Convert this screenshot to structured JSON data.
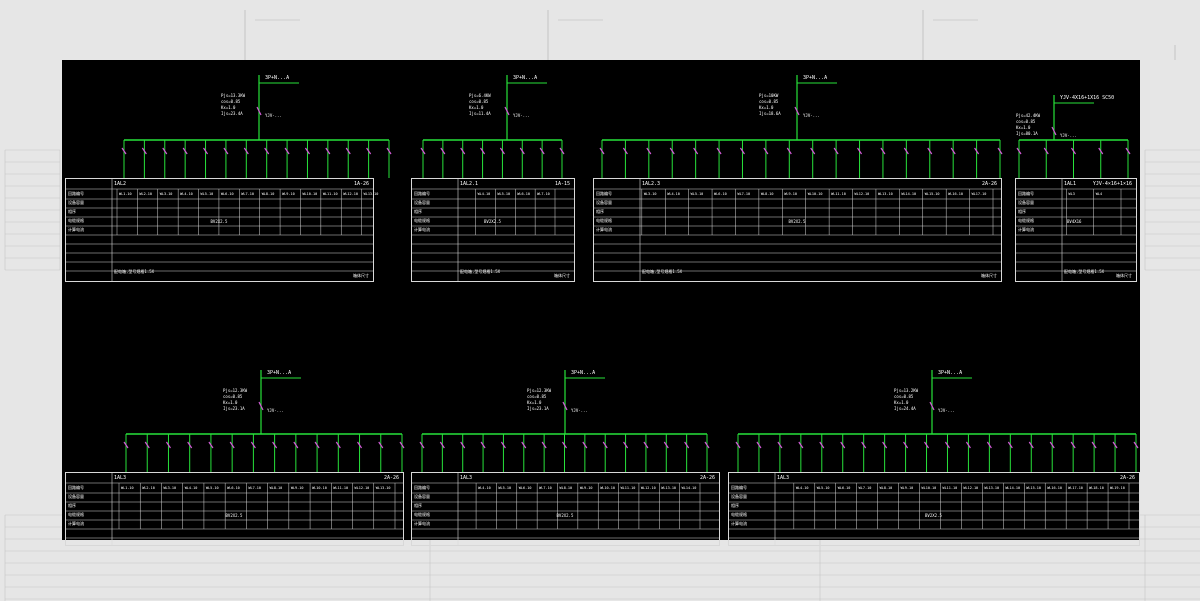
{
  "panels": [
    {
      "id": "p1",
      "title": "1AL2",
      "code": "1A-26",
      "power": "Pjs=13.3KW",
      "cos": "cos=0.85",
      "kx": "Kx=1.0",
      "ij": "Ijs=23.4A",
      "breaker": "3P+N...A",
      "feed": "YJV-...",
      "footer": "配电箱,型号规格1.5X",
      "note": "箱体尺寸",
      "circuits": 14,
      "rows": [
        "WL1-10",
        "WL2-10",
        "WL3-10",
        "WL4-10",
        "WL5-10",
        "WL6-10",
        "WL7-10",
        "WL8-10",
        "WL9-10",
        "WL10-10",
        "WL11-10",
        "WL12-10",
        "WL13-10"
      ],
      "midlabel": "BV2X2.5"
    },
    {
      "id": "p2",
      "title": "1AL2.1",
      "code": "1A-15",
      "power": "Pjs=6.4KW",
      "cos": "cos=0.85",
      "kx": "Kx=1.0",
      "ij": "Ijs=11.4A",
      "breaker": "3P+N...A",
      "feed": "YJV-...",
      "footer": "配电箱,型号规格1.5X",
      "note": "箱体尺寸",
      "circuits": 8,
      "rows": [
        "WL1-10",
        "WL2-10",
        "WL3-10",
        "WL4-10",
        "WL5-10",
        "WL6-10",
        "WL7-10"
      ],
      "midlabel": "BV2X2.5"
    },
    {
      "id": "p3",
      "title": "1AL2.3",
      "code": "2A-26",
      "power": "Pjs=10KW",
      "cos": "cos=0.85",
      "kx": "Kx=1.0",
      "ij": "Ijs=18.6A",
      "breaker": "3P+N...A",
      "feed": "YJV-...",
      "footer": "配电箱,型号规格1.5X",
      "note": "箱体尺寸",
      "circuits": 18,
      "rows": [
        "WL1-10",
        "WL2-10",
        "WL3-10",
        "WL4-10",
        "WL5-10",
        "WL6-10",
        "WL7-10",
        "WL8-10",
        "WL9-10",
        "WL10-10",
        "WL11-10",
        "WL12-10",
        "WL13-10",
        "WL14-10",
        "WL15-10",
        "WL16-10",
        "WL17-10"
      ],
      "midlabel": "BV2X2.5"
    },
    {
      "id": "p4",
      "title": "1AL1",
      "code": "YJV-4×16+1×16",
      "power": "Pjs=42.4KW",
      "cos": "cos=0.85",
      "kx": "Kx=1.0",
      "ij": "Ijs=80.1A",
      "breaker": "YJV-4X16+1X16 SC50",
      "feed": "YJV-...",
      "footer": "配电箱,型号规格1.5X",
      "note": "箱体尺寸",
      "circuits": 5,
      "rows": [
        "WL1",
        "WL2",
        "WL3",
        "WL4"
      ],
      "midlabel": "BV4X16"
    },
    {
      "id": "p5",
      "title": "1AL3",
      "code": "2A-26",
      "power": "Pjs=12.3KW",
      "cos": "cos=0.85",
      "kx": "Kx=1.0",
      "ij": "Ijs=23.1A",
      "breaker": "3P+N...A",
      "feed": "YJV-...",
      "footer": "",
      "note": "",
      "circuits": 14,
      "rows": [
        "WL1-10",
        "WL2-10",
        "WL3-10",
        "WL4-10",
        "WL5-10",
        "WL6-10",
        "WL7-10",
        "WL8-10",
        "WL9-10",
        "WL10-10",
        "WL11-10",
        "WL12-10",
        "WL13-10"
      ],
      "midlabel": "BV2X2.5"
    },
    {
      "id": "p6",
      "title": "1AL3",
      "code": "2A-26",
      "power": "Pjs=12.3KW",
      "cos": "cos=0.85",
      "kx": "Kx=1.0",
      "ij": "Ijs=23.1A",
      "breaker": "3P+N...A",
      "feed": "YJV-...",
      "footer": "",
      "note": "",
      "circuits": 15,
      "rows": [
        "WL1-10",
        "WL2-10",
        "WL3-10",
        "WL4-10",
        "WL5-10",
        "WL6-10",
        "WL7-10",
        "WL8-10",
        "WL9-10",
        "WL10-10",
        "WL11-10",
        "WL12-10",
        "WL13-10",
        "WL14-10"
      ],
      "midlabel": "BV2X2.5"
    },
    {
      "id": "p7",
      "title": "1AL3",
      "code": "2A-26",
      "power": "Pjs=13.2KW",
      "cos": "cos=0.85",
      "kx": "Kx=1.0",
      "ij": "Ijs=24.4A",
      "breaker": "3P+N...A",
      "feed": "YJV-...",
      "footer": "",
      "note": "",
      "circuits": 20,
      "rows": [
        "WL1-10",
        "WL2-10",
        "WL3-10",
        "WL4-10",
        "WL5-10",
        "WL6-10",
        "WL7-10",
        "WL8-10",
        "WL9-10",
        "WL10-10",
        "WL11-10",
        "WL12-10",
        "WL13-10",
        "WL14-10",
        "WL15-10",
        "WL16-10",
        "WL17-10",
        "WL18-10",
        "WL19-10"
      ],
      "midlabel": "BV2X2.5"
    }
  ],
  "rowHeads": [
    "回路编号",
    "设备容量",
    "相序",
    "电缆规格",
    "计算电流"
  ],
  "colors": {
    "bus": "#27e23a",
    "breaker": "#d35bd8",
    "text": "#ffffff",
    "table": "#d8d8d8",
    "background": "#000000",
    "page": "#e6e6e6"
  }
}
